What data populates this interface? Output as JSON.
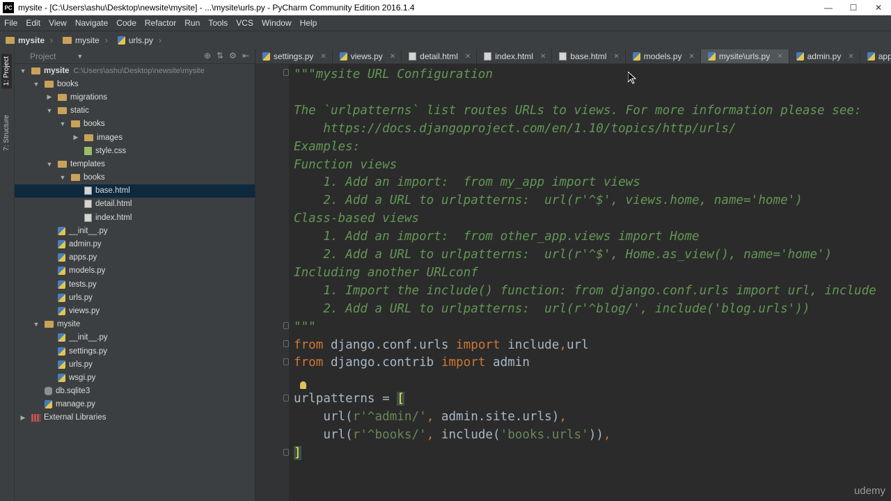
{
  "window": {
    "title": "mysite - [C:\\Users\\ashu\\Desktop\\newsite\\mysite] - ...\\mysite\\urls.py - PyCharm Community Edition 2016.1.4",
    "app_icon_label": "PC"
  },
  "menu": [
    "File",
    "Edit",
    "View",
    "Navigate",
    "Code",
    "Refactor",
    "Run",
    "Tools",
    "VCS",
    "Window",
    "Help"
  ],
  "breadcrumb": [
    "mysite",
    "mysite",
    "urls.py"
  ],
  "toolstrip": {
    "project_tab": "1: Project",
    "structure_tab": "7: Structure"
  },
  "project_panel": {
    "header": "Project",
    "root_path": "C:\\Users\\ashu\\Desktop\\newsite\\mysite",
    "tree": [
      {
        "label": "mysite",
        "type": "folder",
        "depth": 0,
        "expanded": true
      },
      {
        "label": "books",
        "type": "folder",
        "depth": 1,
        "expanded": true
      },
      {
        "label": "migrations",
        "type": "folder",
        "depth": 2,
        "expanded": false
      },
      {
        "label": "static",
        "type": "folder",
        "depth": 2,
        "expanded": true
      },
      {
        "label": "books",
        "type": "folder",
        "depth": 3,
        "expanded": true
      },
      {
        "label": "images",
        "type": "folder",
        "depth": 4,
        "expanded": false
      },
      {
        "label": "style.css",
        "type": "css",
        "depth": 4
      },
      {
        "label": "templates",
        "type": "folder",
        "depth": 2,
        "expanded": true
      },
      {
        "label": "books",
        "type": "folder",
        "depth": 3,
        "expanded": true
      },
      {
        "label": "base.html",
        "type": "html",
        "depth": 4,
        "selected": true
      },
      {
        "label": "detail.html",
        "type": "html",
        "depth": 4
      },
      {
        "label": "index.html",
        "type": "html",
        "depth": 4
      },
      {
        "label": "__init__.py",
        "type": "py",
        "depth": 2
      },
      {
        "label": "admin.py",
        "type": "py",
        "depth": 2
      },
      {
        "label": "apps.py",
        "type": "py",
        "depth": 2
      },
      {
        "label": "models.py",
        "type": "py",
        "depth": 2
      },
      {
        "label": "tests.py",
        "type": "py",
        "depth": 2
      },
      {
        "label": "urls.py",
        "type": "py",
        "depth": 2
      },
      {
        "label": "views.py",
        "type": "py",
        "depth": 2
      },
      {
        "label": "mysite",
        "type": "folder",
        "depth": 1,
        "expanded": true
      },
      {
        "label": "__init__.py",
        "type": "py",
        "depth": 2
      },
      {
        "label": "settings.py",
        "type": "py",
        "depth": 2
      },
      {
        "label": "urls.py",
        "type": "py",
        "depth": 2
      },
      {
        "label": "wsgi.py",
        "type": "py",
        "depth": 2
      },
      {
        "label": "db.sqlite3",
        "type": "db",
        "depth": 1
      },
      {
        "label": "manage.py",
        "type": "py",
        "depth": 1
      },
      {
        "label": "External Libraries",
        "type": "lib",
        "depth": 0,
        "expanded": false
      }
    ]
  },
  "tabs": [
    {
      "label": "settings.py",
      "type": "py"
    },
    {
      "label": "views.py",
      "type": "py"
    },
    {
      "label": "detail.html",
      "type": "html"
    },
    {
      "label": "index.html",
      "type": "html"
    },
    {
      "label": "base.html",
      "type": "html"
    },
    {
      "label": "models.py",
      "type": "py"
    },
    {
      "label": "mysite\\urls.py",
      "type": "py",
      "active": true
    },
    {
      "label": "admin.py",
      "type": "py"
    },
    {
      "label": "apps.py",
      "type": "py"
    }
  ],
  "code_lines": [
    [
      {
        "t": "\"\"\"mysite URL Configuration",
        "c": "doc"
      }
    ],
    [],
    [
      {
        "t": "The `urlpatterns` list routes URLs to views. For more information please see:",
        "c": "doc"
      }
    ],
    [
      {
        "t": "    https://docs.djangoproject.com/en/1.10/topics/http/urls/",
        "c": "doc"
      }
    ],
    [
      {
        "t": "Examples:",
        "c": "doc"
      }
    ],
    [
      {
        "t": "Function views",
        "c": "doc"
      }
    ],
    [
      {
        "t": "    1. Add an import:  from my_app import views",
        "c": "doc"
      }
    ],
    [
      {
        "t": "    2. Add a URL to urlpatterns:  url(r'^$', views.home, name='home')",
        "c": "doc"
      }
    ],
    [
      {
        "t": "Class-based views",
        "c": "doc"
      }
    ],
    [
      {
        "t": "    1. Add an import:  from other_app.views import Home",
        "c": "doc"
      }
    ],
    [
      {
        "t": "    2. Add a URL to urlpatterns:  url(r'^$', Home.as_view(), name='home')",
        "c": "doc"
      }
    ],
    [
      {
        "t": "Including another URLconf",
        "c": "doc"
      }
    ],
    [
      {
        "t": "    1. Import the include() function: from django.conf.urls import url, include",
        "c": "doc"
      }
    ],
    [
      {
        "t": "    2. Add a URL to urlpatterns:  url(r'^blog/', include('blog.urls'))",
        "c": "doc"
      }
    ],
    [
      {
        "t": "\"\"\"",
        "c": "doc"
      }
    ],
    [
      {
        "t": "from",
        "c": "kw"
      },
      {
        "t": " django.conf.urls ",
        "c": "plain"
      },
      {
        "t": "import",
        "c": "kw"
      },
      {
        "t": " include",
        "c": "plain"
      },
      {
        "t": ",",
        "c": "kw"
      },
      {
        "t": "url",
        "c": "plain"
      }
    ],
    [
      {
        "t": "from",
        "c": "kw"
      },
      {
        "t": " django.contrib ",
        "c": "plain"
      },
      {
        "t": "import",
        "c": "kw"
      },
      {
        "t": " admin",
        "c": "plain"
      }
    ],
    [],
    [
      {
        "t": "urlpatterns = ",
        "c": "plain"
      },
      {
        "t": "[",
        "c": "bracket"
      }
    ],
    [
      {
        "t": "    url(",
        "c": "plain"
      },
      {
        "t": "r'^admin/'",
        "c": "str"
      },
      {
        "t": ", ",
        "c": "kw"
      },
      {
        "t": "admin.site.urls)",
        "c": "plain"
      },
      {
        "t": ",",
        "c": "kw"
      }
    ],
    [
      {
        "t": "    url(",
        "c": "plain"
      },
      {
        "t": "r'^books/'",
        "c": "str"
      },
      {
        "t": ", ",
        "c": "kw"
      },
      {
        "t": "include(",
        "c": "plain"
      },
      {
        "t": "'books.urls'",
        "c": "str"
      },
      {
        "t": "))",
        "c": "plain"
      },
      {
        "t": ",",
        "c": "kw"
      }
    ],
    [
      {
        "t": "]",
        "c": "bracket"
      }
    ]
  ],
  "watermark": "udemy"
}
